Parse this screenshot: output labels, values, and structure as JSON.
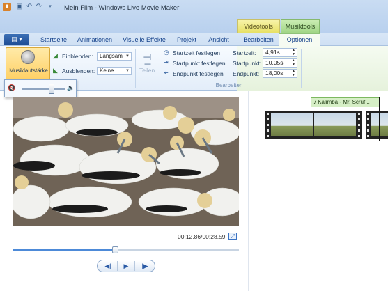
{
  "window": {
    "title": "Mein Film - Windows Live Movie Maker"
  },
  "context_tabs": {
    "video": "Videotools",
    "music": "Musiktools"
  },
  "tabs": {
    "start": "Startseite",
    "animations": "Animationen",
    "visual_effects": "Visuelle Effekte",
    "project": "Projekt",
    "view": "Ansicht",
    "edit": "Bearbeiten",
    "options": "Optionen"
  },
  "ribbon": {
    "music_volume": "Musiklautstärke",
    "fade_in_label": "Einblenden:",
    "fade_in_value": "Langsam",
    "fade_out_label": "Ausblenden:",
    "fade_out_value": "Keine",
    "split": "Teilen",
    "set_start_time": "Startzeit festlegen",
    "set_start_point": "Startpunkt festlegen",
    "set_end_point": "Endpunkt festlegen",
    "start_time_label": "Startzeit:",
    "start_time_value": "4,91s",
    "start_point_label": "Startpunkt:",
    "start_point_value": "10,05s",
    "end_point_label": "Endpunkt:",
    "end_point_value": "18,00s",
    "group_edit": "Bearbeiten"
  },
  "volume_popup": {
    "level_percent": 70
  },
  "player": {
    "timecode": "00:12,86/00:28,59",
    "progress_percent": 45,
    "prev_frame": "◀|",
    "play": "▶",
    "next_frame": "|▶"
  },
  "storyboard": {
    "music_clip_label": "♪ Kalimba - Mr. Scruf..."
  },
  "colors": {
    "accent": "#4d8ad8",
    "music_green": "#9fd484",
    "video_yellow": "#e6df62"
  }
}
